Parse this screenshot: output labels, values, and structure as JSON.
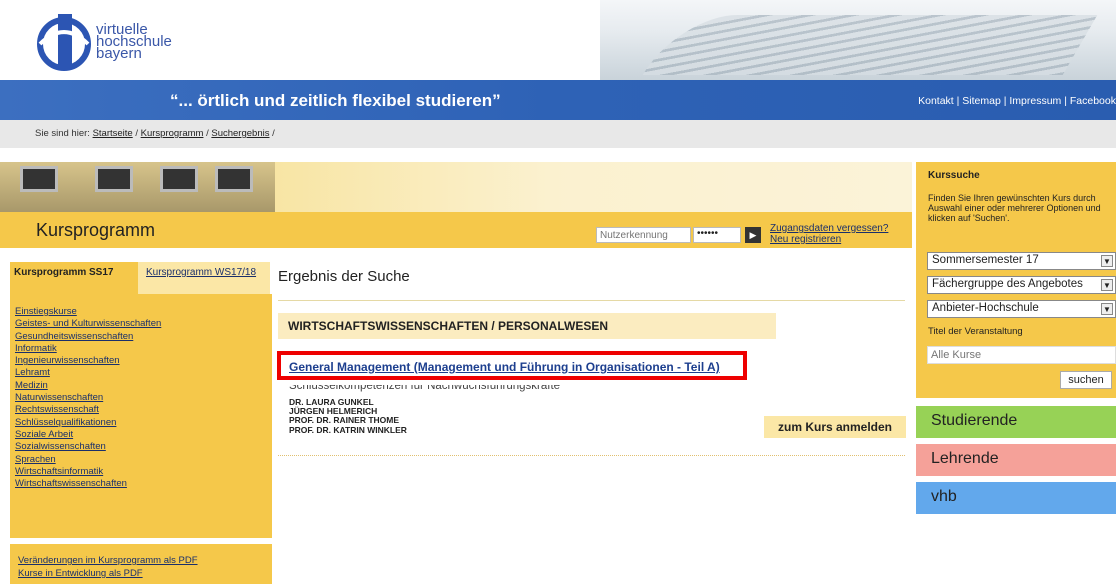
{
  "header": {
    "logo_lines": [
      "virtuelle",
      "hochschule",
      "bayern"
    ],
    "slogan": "“... örtlich und zeitlich flexibel studieren”",
    "top_links": [
      "Kontakt",
      "Sitemap",
      "Impressum",
      "Facebook"
    ]
  },
  "breadcrumb": {
    "prefix": "Sie sind hier:",
    "items": [
      "Startseite",
      "Kursprogramm",
      "Suchergebnis"
    ]
  },
  "kursprogramm": {
    "title": "Kursprogramm",
    "login": {
      "user_placeholder": "Nutzerkennung",
      "password_value": "••••••",
      "forgot_link": "Zugangsdaten vergessen?",
      "register_link": "Neu registrieren"
    }
  },
  "left_sidebar": {
    "tabs": [
      "Kursprogramm SS17",
      "Kursprogramm WS17/18"
    ],
    "categories": [
      "Einstiegskurse",
      "Geistes- und Kulturwissenschaften",
      "Gesundheitswissenschaften",
      "Informatik",
      "Ingenieurwissenschaften",
      "Lehramt",
      "Medizin",
      "Naturwissenschaften",
      "Rechtswissenschaft",
      "Schlüsselqualifikationen",
      "Soziale Arbeit",
      "Sozialwissenschaften",
      "Sprachen",
      "Wirtschaftsinformatik",
      "Wirtschaftswissenschaften"
    ],
    "pdf_links": [
      "Veränderungen im Kursprogramm als PDF",
      "Kurse in Entwicklung als PDF"
    ]
  },
  "main": {
    "title": "Ergebnis der Suche",
    "category_heading": "WIRTSCHAFTSWISSENSCHAFTEN / PERSONALWESEN",
    "course": {
      "title": "General Management (Management und Führung in Organisationen - Teil A)",
      "subtitle": "Schlüsselkompetenzen für Nachwuchsführungskräfte",
      "lecturers": [
        "DR. LAURA GUNKEL",
        "JÜRGEN HELMERICH",
        "PROF. DR. RAINER THOME",
        "PROF. DR. KATRIN WINKLER"
      ],
      "enroll_label": "zum Kurs anmelden"
    }
  },
  "right_sidebar": {
    "title": "Kurssuche",
    "description": "Finden Sie Ihren gewünschten Kurs durch Auswahl einer oder mehrerer Optionen und klicken auf 'Suchen'.",
    "selects": [
      "Sommersemester 17",
      "Fächergruppe des Angebotes",
      "Anbieter-Hochschule"
    ],
    "title_label": "Titel der Veranstaltung",
    "title_placeholder": "Alle Kurse",
    "search_label": "suchen",
    "boxes": [
      "Studierende",
      "Lehrende",
      "vhb"
    ]
  },
  "colors": {
    "accent_yellow": "#f5c84a",
    "header_blue": "#2e62b6",
    "highlight_red": "#ee0000",
    "studierende": "#97d256",
    "lehrende": "#f5a199",
    "vhb": "#62a8ec"
  }
}
